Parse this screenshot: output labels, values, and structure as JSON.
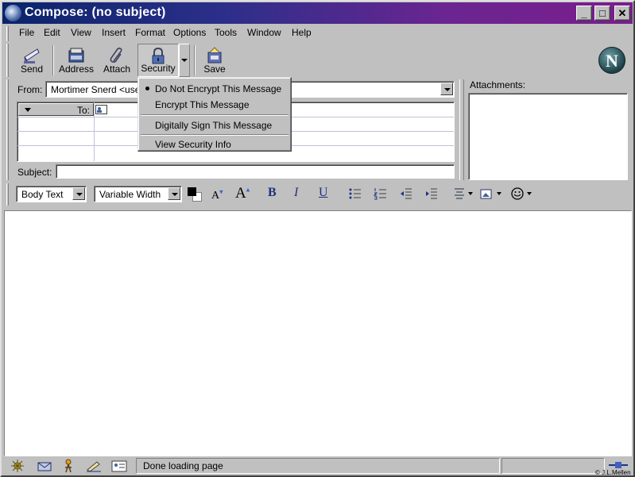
{
  "window": {
    "title": "Compose: (no subject)",
    "min_label": "_",
    "max_label": "□",
    "close_label": "✕"
  },
  "menu": [
    {
      "label": "File",
      "accel": "F"
    },
    {
      "label": "Edit",
      "accel": "E"
    },
    {
      "label": "View",
      "accel": "V"
    },
    {
      "label": "Insert",
      "accel": "I"
    },
    {
      "label": "Format",
      "accel": "o"
    },
    {
      "label": "Options",
      "accel": "p"
    },
    {
      "label": "Tools",
      "accel": "T"
    },
    {
      "label": "Window",
      "accel": "W"
    },
    {
      "label": "Help",
      "accel": "H"
    }
  ],
  "toolbar": {
    "send": "Send",
    "address": "Address",
    "attach": "Attach",
    "security": "Security",
    "save": "Save"
  },
  "address": {
    "from_label": "From:",
    "from_value": "Mortimer Snerd <usern",
    "to_label": "To:",
    "subject_label": "Subject:",
    "subject_value": "",
    "attachments_label": "Attachments:"
  },
  "security_menu": {
    "items": [
      {
        "label": "Do Not Encrypt This Message",
        "checked": true
      },
      {
        "label": "Encrypt This Message",
        "checked": false
      },
      {
        "label": "Digitally Sign This Message",
        "checked": false
      },
      {
        "label": "View Security Info",
        "checked": false
      }
    ]
  },
  "format": {
    "paragraph_style": "Body Text",
    "font": "Variable Width",
    "bold": "B",
    "italic": "I",
    "underline": "U"
  },
  "status": {
    "text": "Done loading page",
    "credit": "© J.L.Mellen"
  },
  "colors": {
    "title_start": "#0a246a",
    "title_end": "#7a1e8c",
    "face": "#c0c0c0"
  }
}
